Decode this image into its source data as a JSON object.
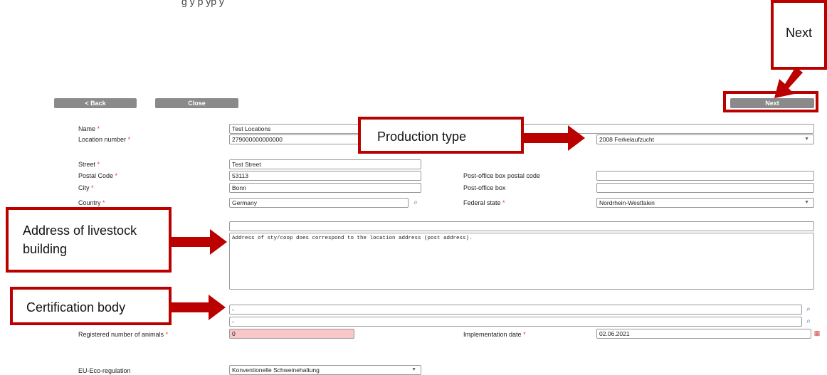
{
  "top_text": "g y                                     p                         yp                                             y",
  "toolbar": {
    "back": "< Back",
    "close": "Close",
    "next": "Next"
  },
  "form": {
    "name_label": "Name",
    "name_value": "Test Locations",
    "location_number_label": "Location number",
    "location_number_value": "279000000000000",
    "production_type_value": "2008 Ferkelaufzucht",
    "street_label": "Street",
    "street_value": "Test Street",
    "postal_code_label": "Postal Code",
    "postal_code_value": "53113",
    "city_label": "City",
    "city_value": "Bonn",
    "country_label": "Country",
    "country_value": "Germany",
    "po_box_postal_code_label": "Post-office box postal code",
    "po_box_postal_code_value": "",
    "po_box_label": "Post-office box",
    "po_box_value": "",
    "federal_state_label": "Federal state",
    "federal_state_value": "Nordrhein-Westfalen",
    "address_line_value": "",
    "address_text": "Address of sty/coop does correspond to the location address (post address).",
    "cert_body_1": "-",
    "cert_body_2": "-",
    "registered_animals_label": "Registered number of animals",
    "registered_animals_value": "0",
    "implementation_date_label": "Implementation date",
    "implementation_date_value": "02.06.2021",
    "eu_eco_label": "EU-Eco-regulation",
    "eu_eco_value": "Konventionelle Schweinehaltung",
    "required_mark": "*"
  },
  "callouts": {
    "next": "Next",
    "production_type": "Production type",
    "address_livestock": "Address of livestock building",
    "certification_body": "Certification body"
  },
  "colors": {
    "callout_red": "#b00000",
    "button_gray": "#8a8a8a",
    "error_fill": "#f9c7c7"
  }
}
